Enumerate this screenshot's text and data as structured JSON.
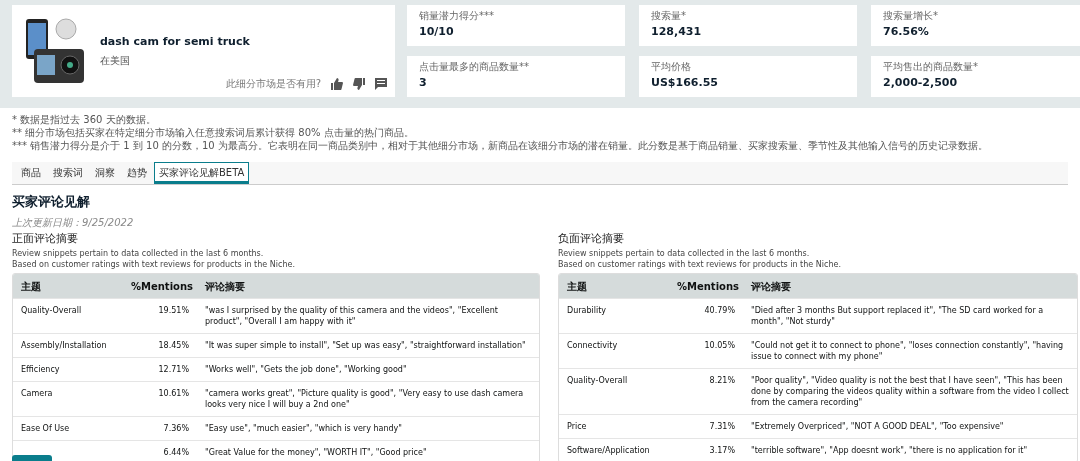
{
  "product": {
    "title": "dash cam for semi truck",
    "marketplace": "在美国",
    "feedback_prompt": "此细分市场是否有用?"
  },
  "stats": [
    {
      "label": "销量潜力得分***",
      "value": "10/10"
    },
    {
      "label": "搜索量*",
      "value": "128,431"
    },
    {
      "label": "搜索量增长*",
      "value": "76.56%"
    },
    {
      "label": "点击量最多的商品数量**",
      "value": "3"
    },
    {
      "label": "平均价格",
      "value": "US$166.55"
    },
    {
      "label": "平均售出的商品数量*",
      "value": "2,000-2,500"
    }
  ],
  "notes": [
    "* 数据是指过去 360 天的数据。",
    "** 细分市场包括买家在特定细分市场输入任意搜索词后累计获得 80% 点击量的热门商品。",
    "*** 销售潜力得分是介于 1 到 10 的分数，10 为最高分。它表明在同一商品类别中，相对于其他细分市场，新商品在该细分市场的潜在销量。此分数是基于商品销量、买家搜索量、季节性及其他输入信号的历史记录数据。"
  ],
  "tabs": [
    {
      "label": "商品",
      "selected": false
    },
    {
      "label": "搜索词",
      "selected": false
    },
    {
      "label": "洞察",
      "selected": false
    },
    {
      "label": "趋势",
      "selected": false
    },
    {
      "label": "买家评论见解BETA",
      "selected": true
    }
  ],
  "section_title": "买家评论见解",
  "last_updated": "上次更新日期：9/25/2022",
  "panels": [
    {
      "title": "正面评论摘要",
      "description": [
        "Review snippets pertain to data collected in the last 6 months.",
        "Based on customer ratings with text reviews for products in the Niche."
      ],
      "columns": [
        "主题",
        "%Mentions",
        "评论摘要"
      ],
      "rows": [
        {
          "topic": "Quality-Overall",
          "mentions": "19.51%",
          "snippet": "\"was I surprised by the quality of this camera and the videos\", \"Excellent product\", \"Overall I am happy with it\""
        },
        {
          "topic": "Assembly/Installation",
          "mentions": "18.45%",
          "snippet": "\"It was super simple to install\", \"Set up was easy\", \"straightforward installation\""
        },
        {
          "topic": "Efficiency",
          "mentions": "12.71%",
          "snippet": "\"Works well\", \"Gets the job done\", \"Working good\""
        },
        {
          "topic": "Camera",
          "mentions": "10.61%",
          "snippet": "\"camera works great\", \"Picture quality is good\", \"Very easy to use dash camera looks very nice I will buy a 2nd one\""
        },
        {
          "topic": "Ease Of Use",
          "mentions": "7.36%",
          "snippet": "\"Easy use\", \"much easier\", \"which is very handy\""
        },
        {
          "mentions": "6.44%",
          "snippet": "\"Great Value for the money\", \"WORTH IT\", \"Good price\""
        }
      ]
    },
    {
      "title": "负面评论摘要",
      "description": [
        "Review snippets pertain to data collected in the last 6 months.",
        "Based on customer ratings with text reviews for products in the Niche."
      ],
      "columns": [
        "主题",
        "%Mentions",
        "评论摘要"
      ],
      "rows": [
        {
          "topic": "Durability",
          "mentions": "40.79%",
          "snippet": "\"Died after 3 months But support replaced it\", \"The SD card worked for a month\", \"Not sturdy\""
        },
        {
          "topic": "Connectivity",
          "mentions": "10.05%",
          "snippet": "\"Could not get it to connect to phone\", \"loses connection constantly\", \"having issue to connect with my phone\""
        },
        {
          "topic": "Quality-Overall",
          "mentions": "8.21%",
          "snippet": "\"Poor quality\", \"Video quality is not the best that I have seen\", \"This has been done by comparing the videos quality within a software from the video I collect from the camera recording\""
        },
        {
          "topic": "Price",
          "mentions": "7.31%",
          "snippet": "\"Extremely Overpriced\", \"NOT A GOOD DEAL\", \"Too expensive\""
        },
        {
          "topic": "Software/Application",
          "mentions": "3.17%",
          "snippet": "\"terrible software\", \"App doesnt work\", \"there is no application for it\""
        }
      ]
    }
  ]
}
